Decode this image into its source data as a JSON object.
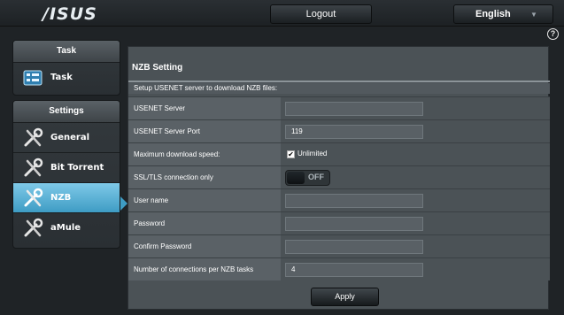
{
  "header": {
    "logo": "/ISUS",
    "logout_label": "Logout",
    "language": "English"
  },
  "sidebar": {
    "task_header": "Task",
    "task_item": "Task",
    "settings_header": "Settings",
    "items": [
      {
        "label": "General",
        "icon": "wrench-screwdriver-icon"
      },
      {
        "label": "Bit Torrent",
        "icon": "wrench-screwdriver-icon"
      },
      {
        "label": "NZB",
        "icon": "wrench-screwdriver-icon"
      },
      {
        "label": "aMule",
        "icon": "wrench-screwdriver-icon"
      }
    ],
    "active": "NZB"
  },
  "main": {
    "title": "NZB Setting",
    "description": "Setup USENET server to download NZB files:",
    "fields": {
      "usenet_server": {
        "label": "USENET Server",
        "value": ""
      },
      "usenet_port": {
        "label": "USENET Server Port",
        "value": "119"
      },
      "max_speed": {
        "label": "Maximum download speed:",
        "checkbox_label": "Unlimited",
        "checked": true
      },
      "ssl_only": {
        "label": "SSL/TLS connection only",
        "toggle_text": "OFF"
      },
      "username": {
        "label": "User name",
        "value": ""
      },
      "password": {
        "label": "Password",
        "value": ""
      },
      "confirm_password": {
        "label": "Confirm Password",
        "value": ""
      },
      "connections": {
        "label": "Number of connections per NZB tasks",
        "value": "4"
      }
    },
    "apply_label": "Apply"
  },
  "colors": {
    "active_accent": "#3e9cc4",
    "panel_bg": "#4b5256",
    "label_bg": "#5a6166"
  }
}
